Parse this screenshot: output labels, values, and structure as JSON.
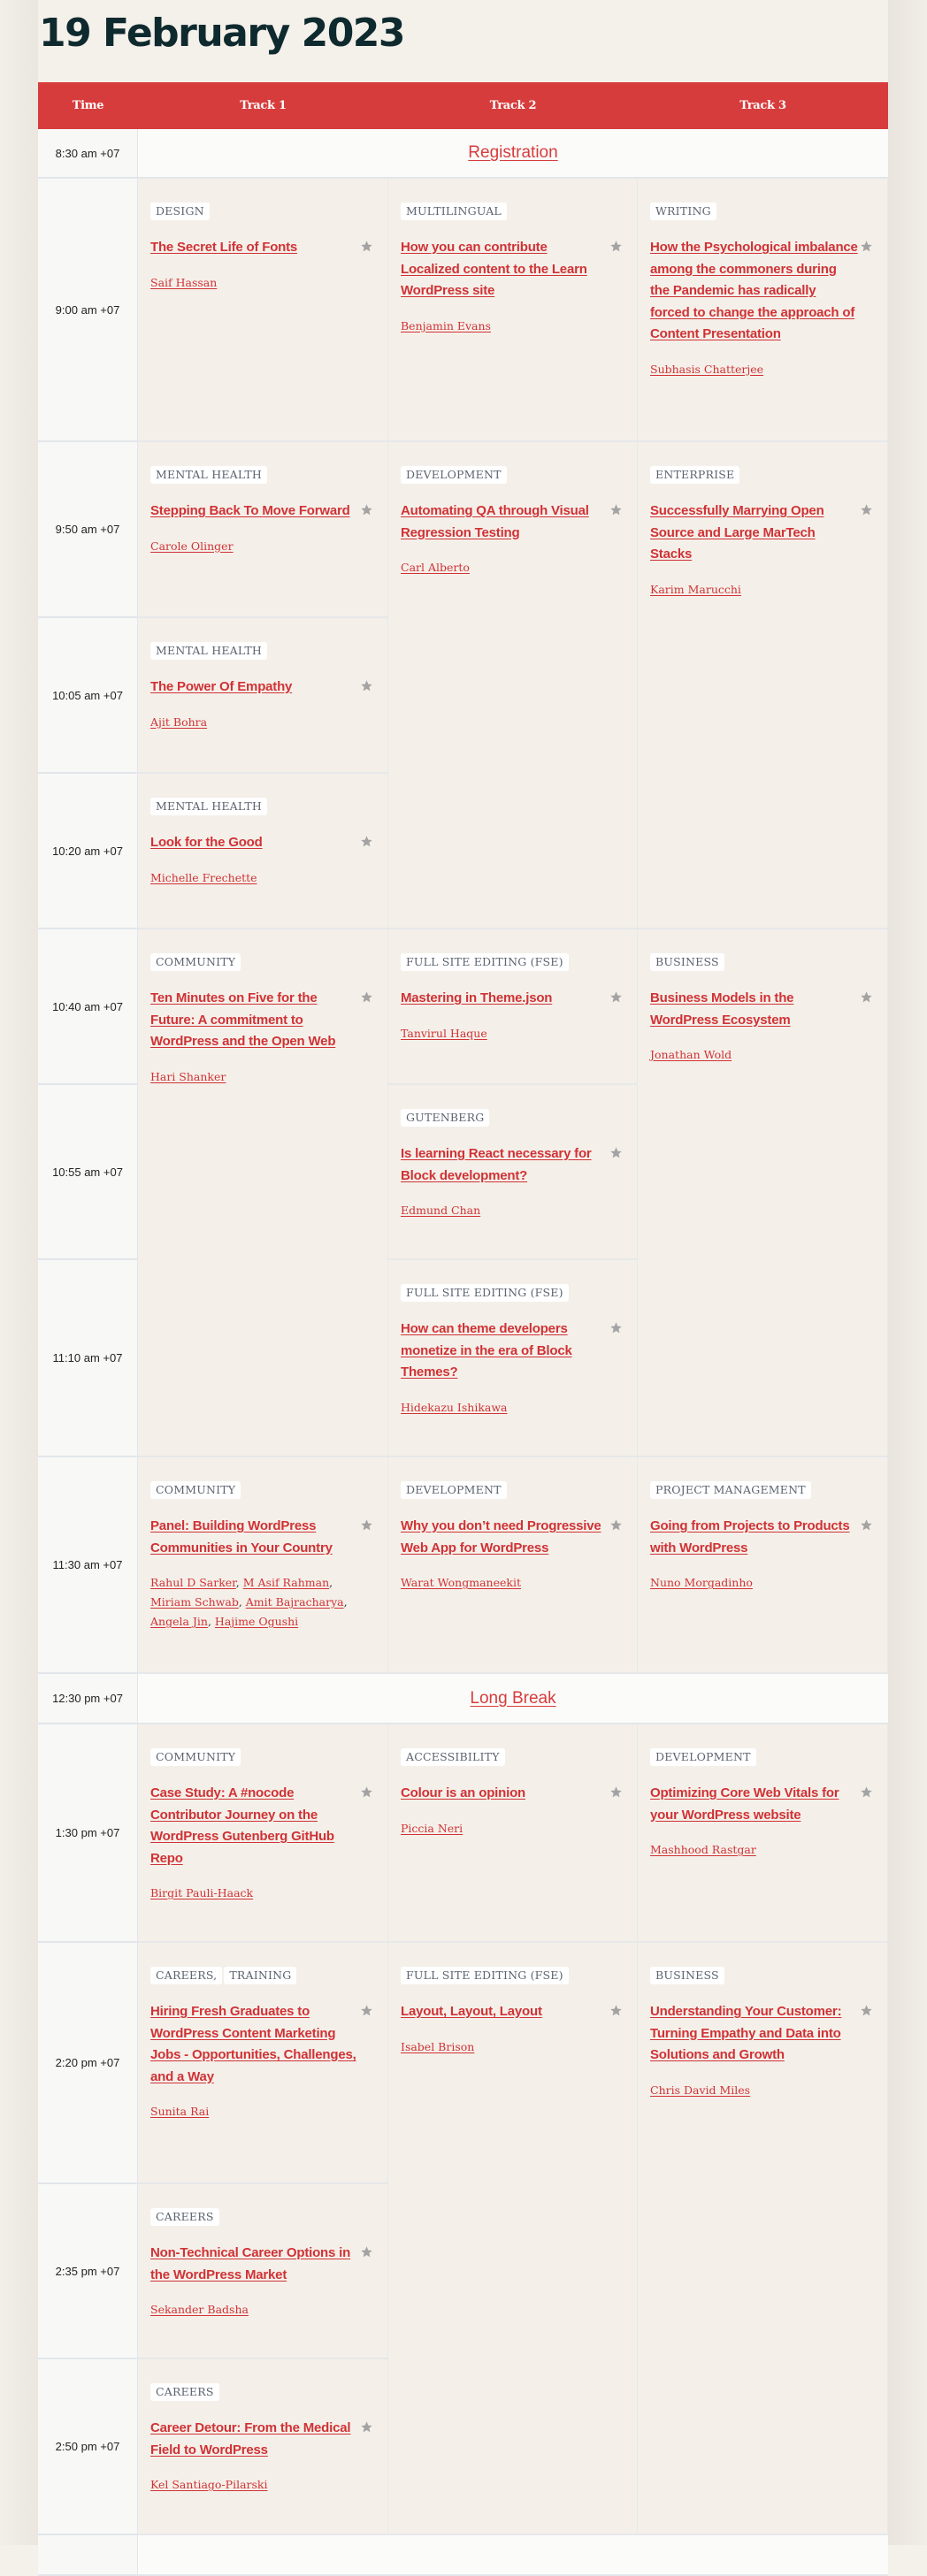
{
  "page_title": "19 February 2023",
  "table": {
    "headers": [
      "Time",
      "Track 1",
      "Track 2",
      "Track 3"
    ],
    "accent_color": "#d73c3c",
    "star_icon": "star-icon",
    "rows": [
      {
        "time": "8:30 am +07",
        "break": "Registration"
      },
      {
        "time": "9:00 am +07"
      },
      {
        "time": "9:50 am +07"
      },
      {
        "time": "10:05 am +07"
      },
      {
        "time": "10:20 am +07"
      },
      {
        "time": "10:40 am +07"
      },
      {
        "time": "10:55 am +07"
      },
      {
        "time": "11:10 am +07"
      },
      {
        "time": "11:30 am +07"
      },
      {
        "time": "12:30 pm +07",
        "break": "Long Break"
      },
      {
        "time": "1:30 pm +07"
      },
      {
        "time": "2:20 pm +07"
      },
      {
        "time": "2:35 pm +07"
      },
      {
        "time": "2:50 pm +07"
      },
      {
        "time": ""
      }
    ],
    "sessions": [
      {
        "track": 1,
        "row": 1,
        "span": 1,
        "tags": [
          "DESIGN"
        ],
        "title": "The Secret Life of Fonts",
        "speakers": [
          "Saif Hassan"
        ]
      },
      {
        "track": 2,
        "row": 1,
        "span": 1,
        "tags": [
          "MULTILINGUAL"
        ],
        "title": "How you can contribute Localized content to the Learn WordPress site",
        "speakers": [
          "Benjamin Evans"
        ]
      },
      {
        "track": 3,
        "row": 1,
        "span": 1,
        "tags": [
          "WRITING"
        ],
        "title": "How the Psychological imbalance among the commoners during the Pandemic has radically forced to change the approach of Content Presentation",
        "speakers": [
          "Subhasis Chatterjee"
        ]
      },
      {
        "track": 1,
        "row": 2,
        "span": 1,
        "tags": [
          "MENTAL HEALTH"
        ],
        "title": "Stepping Back To Move Forward",
        "speakers": [
          "Carole Olinger"
        ]
      },
      {
        "track": 2,
        "row": 2,
        "span": 3,
        "tags": [
          "DEVELOPMENT"
        ],
        "title": "Automating QA through Visual Regression Testing",
        "speakers": [
          "Carl Alberto"
        ]
      },
      {
        "track": 3,
        "row": 2,
        "span": 3,
        "tags": [
          "ENTERPRISE"
        ],
        "title": "Successfully Marrying Open Source and Large MarTech Stacks",
        "speakers": [
          "Karim Marucchi"
        ]
      },
      {
        "track": 1,
        "row": 3,
        "span": 1,
        "tags": [
          "MENTAL HEALTH"
        ],
        "title": "The Power Of Empathy",
        "speakers": [
          "Ajit Bohra"
        ]
      },
      {
        "track": 1,
        "row": 4,
        "span": 1,
        "tags": [
          "MENTAL HEALTH"
        ],
        "title": "Look for the Good",
        "speakers": [
          "Michelle Frechette"
        ]
      },
      {
        "track": 1,
        "row": 5,
        "span": 3,
        "tags": [
          "COMMUNITY"
        ],
        "title": "Ten Minutes on Five for the Future: A commitment to WordPress and the Open Web",
        "speakers": [
          "Hari Shanker"
        ]
      },
      {
        "track": 2,
        "row": 5,
        "span": 1,
        "tags": [
          "FULL SITE EDITING (FSE)"
        ],
        "title": "Mastering in Theme.json",
        "speakers": [
          "Tanvirul Haque"
        ]
      },
      {
        "track": 3,
        "row": 5,
        "span": 3,
        "tags": [
          "BUSINESS"
        ],
        "title": "Business Models in the WordPress Ecosystem",
        "speakers": [
          "Jonathan Wold"
        ]
      },
      {
        "track": 2,
        "row": 6,
        "span": 1,
        "tags": [
          "GUTENBERG"
        ],
        "title": "Is learning React necessary for Block development?",
        "speakers": [
          "Edmund Chan"
        ]
      },
      {
        "track": 2,
        "row": 7,
        "span": 1,
        "tags": [
          "FULL SITE EDITING (FSE)"
        ],
        "title": "How can theme developers monetize in the era of Block Themes?",
        "speakers": [
          "Hidekazu Ishikawa"
        ]
      },
      {
        "track": 1,
        "row": 8,
        "span": 1,
        "tags": [
          "COMMUNITY"
        ],
        "title": "Panel: Building WordPress Communities in Your Country",
        "speakers": [
          "Rahul D Sarker",
          "M Asif Rahman",
          "Miriam Schwab",
          "Amit Bajracharya",
          "Angela Jin",
          "Hajime Ogushi"
        ]
      },
      {
        "track": 2,
        "row": 8,
        "span": 1,
        "tags": [
          "DEVELOPMENT"
        ],
        "title": "Why you don’t need Progressive Web App for WordPress",
        "speakers": [
          "Warat Wongmaneekit"
        ]
      },
      {
        "track": 3,
        "row": 8,
        "span": 1,
        "tags": [
          "PROJECT MANAGEMENT"
        ],
        "title": "Going from Projects to Products with WordPress",
        "speakers": [
          "Nuno Morgadinho"
        ]
      },
      {
        "track": 1,
        "row": 10,
        "span": 1,
        "tags": [
          "COMMUNITY"
        ],
        "title": "Case Study: A #nocode Contributor Journey on the WordPress Gutenberg GitHub Repo",
        "speakers": [
          "Birgit Pauli-Haack"
        ]
      },
      {
        "track": 2,
        "row": 10,
        "span": 1,
        "tags": [
          "ACCESSIBILITY"
        ],
        "title": "Colour is an opinion",
        "speakers": [
          "Piccia Neri"
        ]
      },
      {
        "track": 3,
        "row": 10,
        "span": 1,
        "tags": [
          "DEVELOPMENT"
        ],
        "title": "Optimizing Core Web Vitals for your WordPress website",
        "speakers": [
          "Mashhood Rastgar"
        ]
      },
      {
        "track": 1,
        "row": 11,
        "span": 1,
        "tags": [
          "CAREERS,",
          "TRAINING"
        ],
        "title": "Hiring Fresh Graduates to WordPress Content Marketing Jobs - Opportunities, Challenges, and a Way",
        "speakers": [
          "Sunita Rai"
        ]
      },
      {
        "track": 2,
        "row": 11,
        "span": 3,
        "tags": [
          "FULL SITE EDITING (FSE)"
        ],
        "title": "Layout, Layout, Layout",
        "speakers": [
          "Isabel Brison"
        ]
      },
      {
        "track": 3,
        "row": 11,
        "span": 3,
        "tags": [
          "BUSINESS"
        ],
        "title": "Understanding Your Customer: Turning Empathy and Data into Solutions and Growth",
        "speakers": [
          "Chris David Miles"
        ]
      },
      {
        "track": 1,
        "row": 12,
        "span": 1,
        "tags": [
          "CAREERS"
        ],
        "title": "Non-Technical Career Options in the WordPress Market",
        "speakers": [
          "Sekander Badsha"
        ]
      },
      {
        "track": 1,
        "row": 13,
        "span": 1,
        "tags": [
          "CAREERS"
        ],
        "title": "Career Detour: From the Medical Field to WordPress",
        "speakers": [
          "Kel Santiago-Pilarski"
        ]
      }
    ]
  }
}
